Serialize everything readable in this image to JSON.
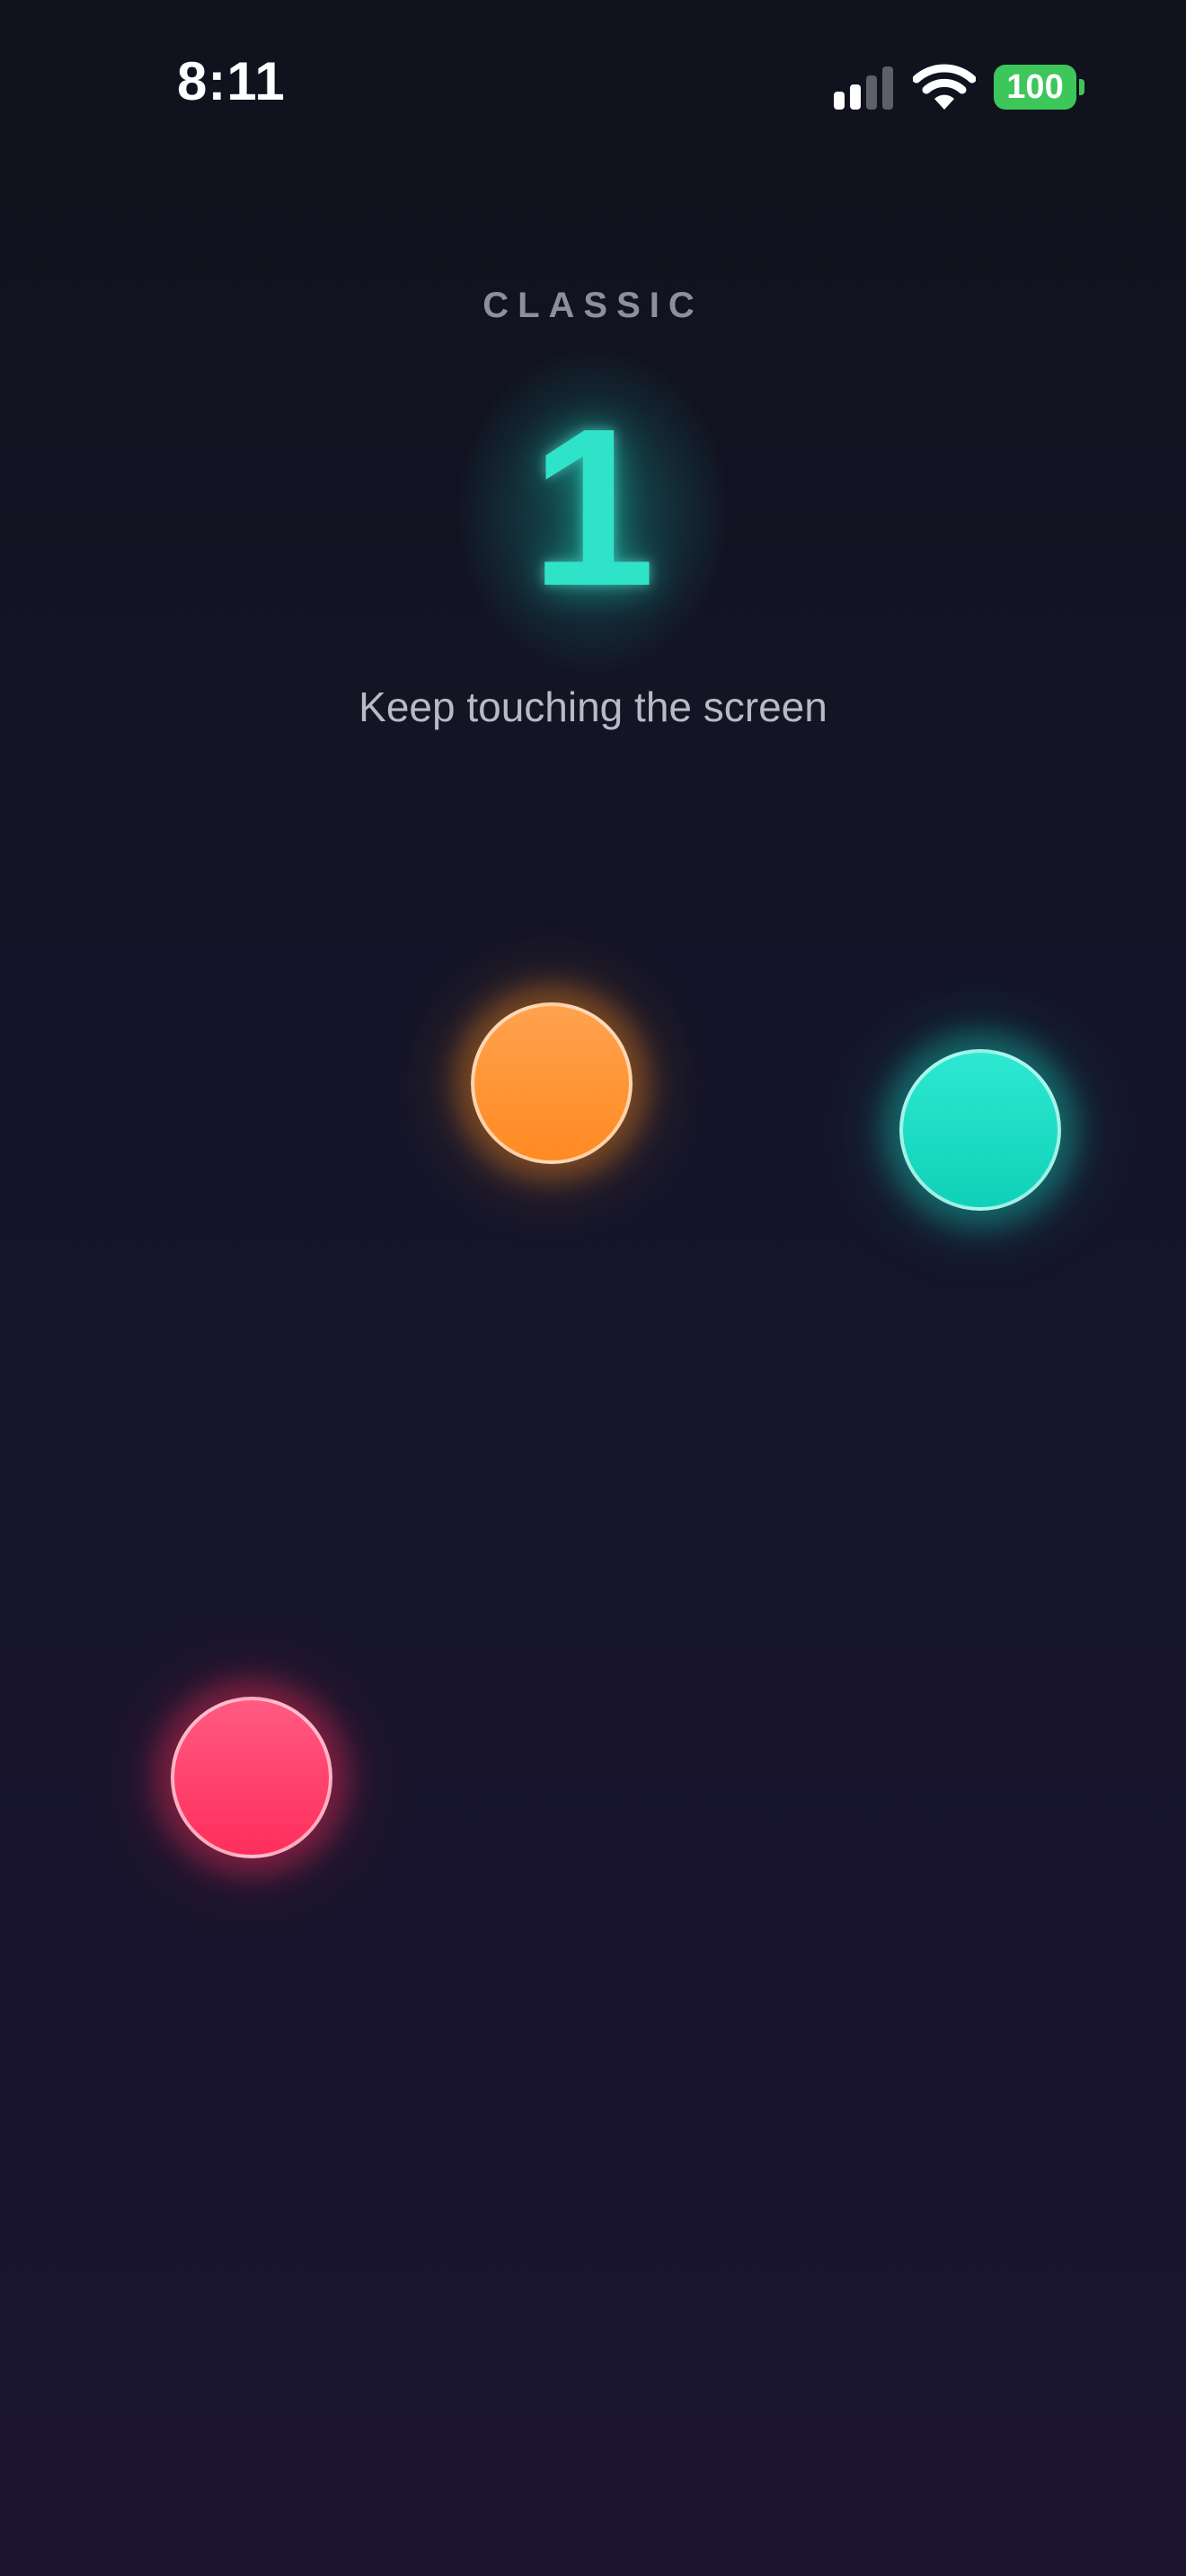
{
  "status_bar": {
    "time": "8:11",
    "battery_level": "100",
    "signal_icon": "cellular-signal-icon",
    "wifi_icon": "wifi-icon",
    "battery_icon": "battery-icon",
    "battery_color": "#3dc65a"
  },
  "header": {
    "mode": "CLASSIC",
    "countdown": "1",
    "instruction": "Keep touching the screen"
  },
  "touches": [
    {
      "color_name": "orange",
      "color": "#ff8a22"
    },
    {
      "color_name": "teal",
      "color": "#0fd1b8"
    },
    {
      "color_name": "red",
      "color": "#ff2e5c"
    }
  ],
  "theme": {
    "background": "#15152a",
    "accent": "#2fe3c8"
  }
}
